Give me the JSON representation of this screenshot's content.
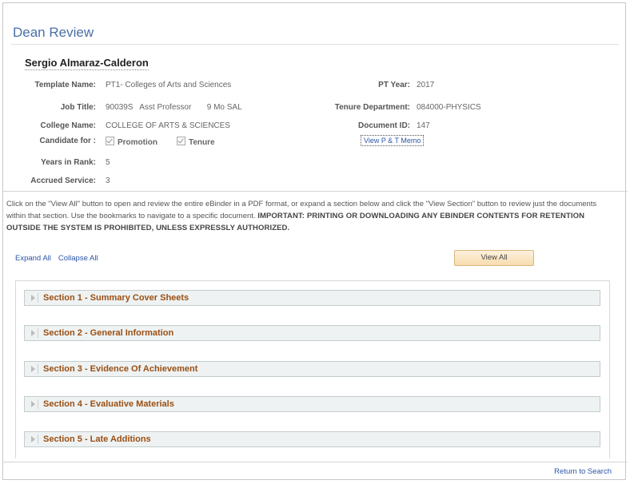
{
  "page": {
    "title": "Dean Review"
  },
  "candidate": {
    "name": "Sergio Almaraz-Calderon",
    "fields_left": [
      {
        "label": "Template Name:",
        "value": "PT1- Colleges of Arts and Sciences"
      },
      {
        "label": "Job Title:",
        "value": "90039S   Asst Professor       9 Mo SAL"
      },
      {
        "label": "College Name:",
        "value": "COLLEGE OF ARTS & SCIENCES"
      },
      {
        "label": "Candidate for :",
        "value": ""
      },
      {
        "label": "Years in Rank:",
        "value": "5"
      },
      {
        "label": "Accrued Service:",
        "value": "3"
      }
    ],
    "candidate_for": {
      "promotion_label": "Promotion",
      "tenure_label": "Tenure"
    },
    "fields_right": [
      {
        "label": "PT Year:",
        "value": "2017"
      },
      {
        "label": "Tenure Department:",
        "value": "084000-PHYSICS"
      },
      {
        "label": "Document ID:",
        "value": "147"
      }
    ],
    "memo_link": "View P & T Memo"
  },
  "instructions": {
    "text": "Click on the \"View All\" button to open and review the entire eBinder in a PDF format, or expand a section below and click the \"View Section\" button to review just the documents within that section. Use the bookmarks to navigate to a specific document. ",
    "warning": "IMPORTANT: PRINTING OR DOWNLOADING ANY EBINDER CONTENTS FOR RETENTION OUTSIDE THE SYSTEM IS PROHIBITED, UNLESS EXPRESSLY AUTHORIZED."
  },
  "controls": {
    "expand_all": "Expand All",
    "collapse_all": "Collapse All",
    "view_all": "View All"
  },
  "sections": [
    {
      "label": "Section 1 - Summary Cover Sheets"
    },
    {
      "label": "Section 2 - General Information"
    },
    {
      "label": "Section 3 - Evidence Of Achievement"
    },
    {
      "label": "Section 4 - Evaluative Materials"
    },
    {
      "label": "Section 5 - Late Additions"
    }
  ],
  "footer": {
    "return_link": "Return to Search"
  },
  "colors": {
    "title": "#4a6fa5",
    "section_text": "#9a4f14",
    "link": "#2a56a8"
  }
}
